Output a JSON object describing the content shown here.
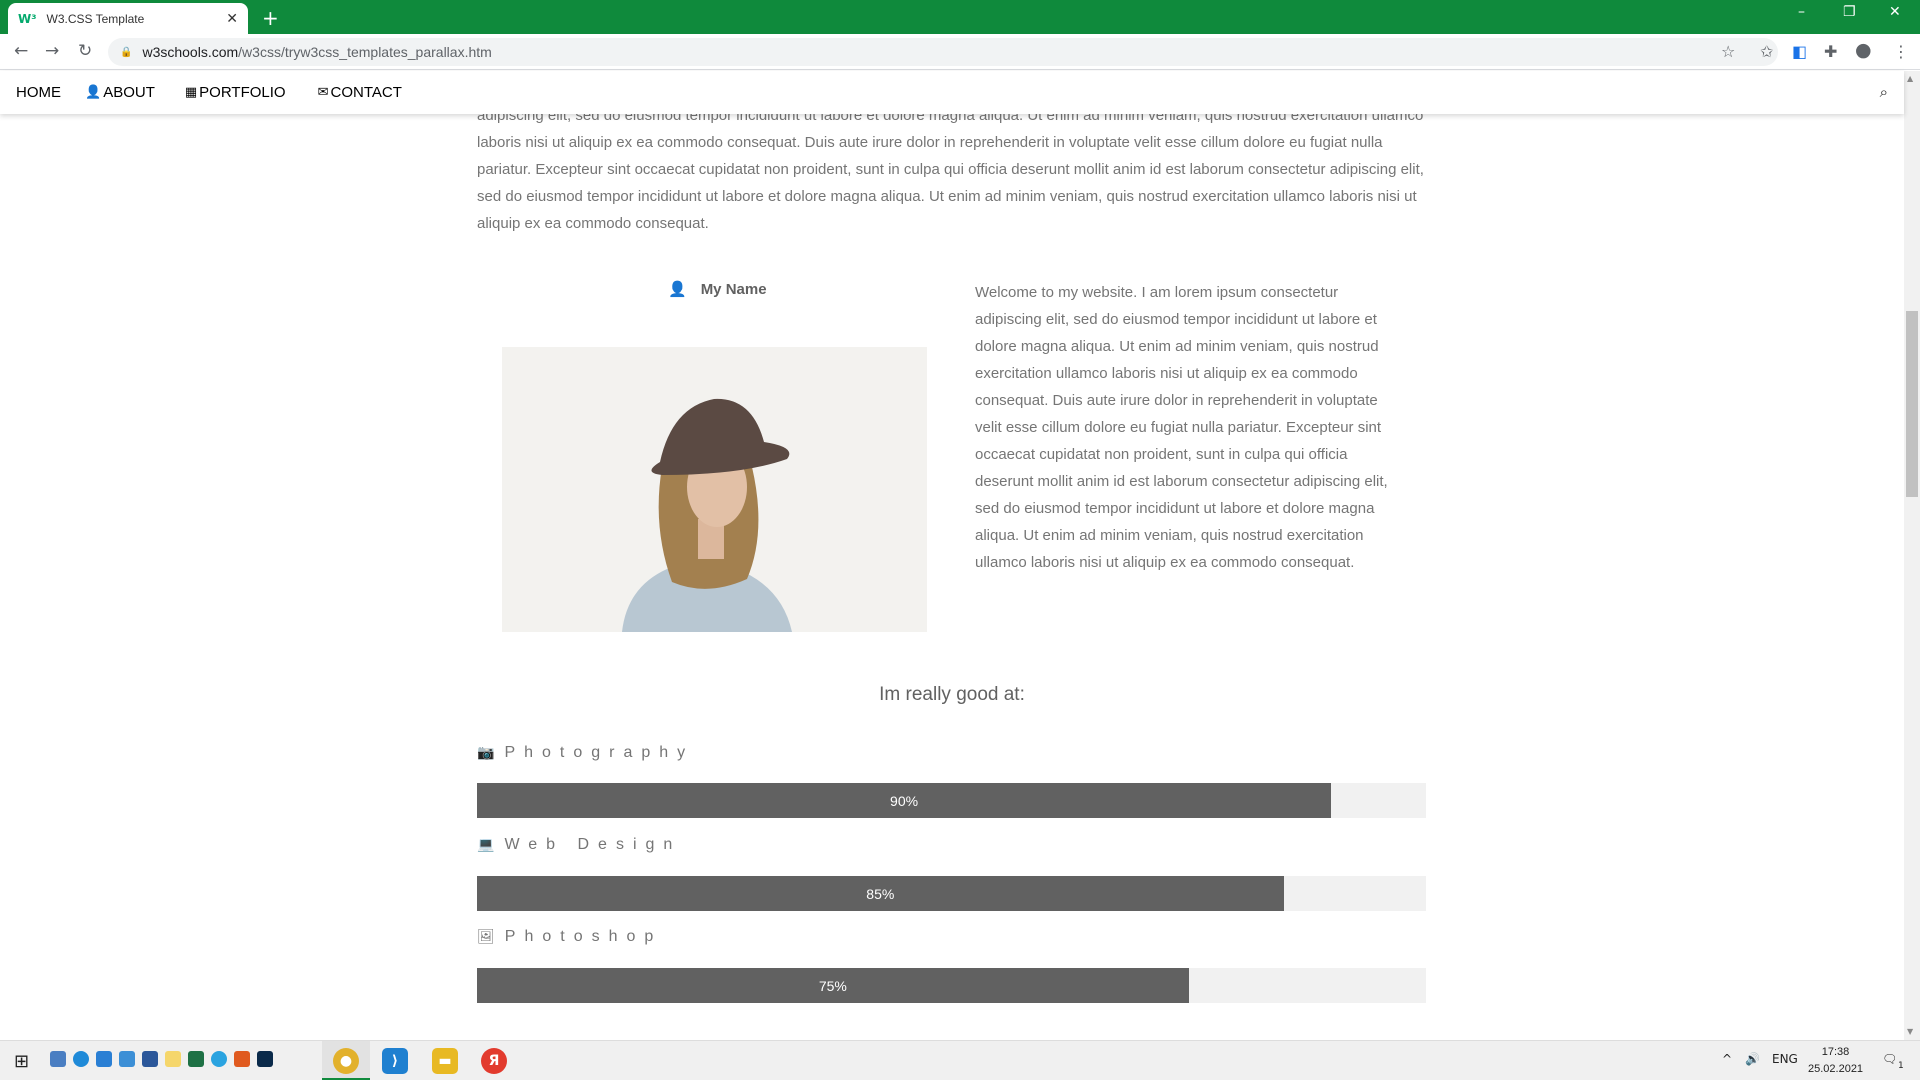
{
  "browser": {
    "tab_title": "W3.CSS Template",
    "tab_favicon": "W³",
    "url_host": "w3schools.com",
    "url_path": "/w3css/tryw3css_templates_parallax.htm",
    "new_tab": "+",
    "win_min": "–",
    "win_max": "❐",
    "win_close": "✕"
  },
  "nav": {
    "home": "HOME",
    "about": "ABOUT",
    "portfolio": "PORTFOLIO",
    "contact": "CONTACT"
  },
  "page": {
    "intro_para": "adipiscing elit, sed do eiusmod tempor incididunt ut labore et dolore magna aliqua. Ut enim ad minim veniam, quis nostrud exercitation ullamco laboris nisi ut aliquip ex ea commodo consequat. Duis aute irure dolor in reprehenderit in voluptate velit esse cillum dolore eu fugiat nulla pariatur. Excepteur sint occaecat cupidatat non proident, sunt in culpa qui officia deserunt mollit anim id est laborum consectetur adipiscing elit, sed do eiusmod tempor incididunt ut labore et dolore magna aliqua. Ut enim ad minim veniam, quis nostrud exercitation ullamco laboris nisi ut aliquip ex ea commodo consequat.",
    "name": "My Name",
    "bio": "Welcome to my website. I am lorem ipsum consectetur adipiscing elit, sed do eiusmod tempor incididunt ut labore et dolore magna aliqua. Ut enim ad minim veniam, quis nostrud exercitation ullamco laboris nisi ut aliquip ex ea commodo consequat. Duis aute irure dolor in reprehenderit in voluptate velit esse cillum dolore eu fugiat nulla pariatur. Excepteur sint occaecat cupidatat non proident, sunt in culpa qui officia deserunt mollit anim id est laborum consectetur adipiscing elit, sed do eiusmod tempor incididunt ut labore et dolore magna aliqua. Ut enim ad minim veniam, quis nostrud exercitation ullamco laboris nisi ut aliquip ex ea commodo consequat.",
    "good_at": "Im really good at:"
  },
  "skills": [
    {
      "label": "Photography",
      "icon": "camera-icon",
      "percent": 90,
      "text": "90%"
    },
    {
      "label": "Web Design",
      "icon": "laptop-icon",
      "percent": 85,
      "text": "85%"
    },
    {
      "label": "Photoshop",
      "icon": "image-icon",
      "percent": 75,
      "text": "75%"
    }
  ],
  "taskbar": {
    "language": "ENG",
    "time": "17:38",
    "date": "25.02.2021",
    "notification_count": "1"
  },
  "colors": {
    "browser_frame": "#0f8a3c",
    "skill_fill": "#616161",
    "skill_track": "#f1f1f1",
    "text_gray": "#757575"
  }
}
